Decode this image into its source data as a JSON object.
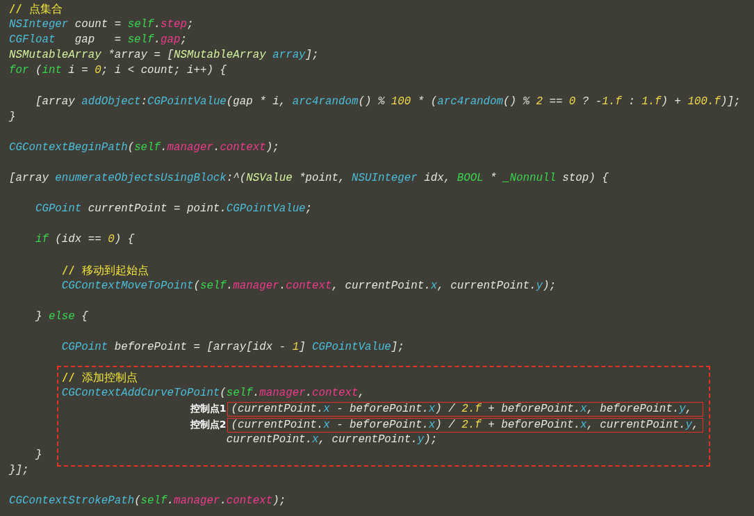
{
  "lines": [
    {
      "kind": "code",
      "tokens": [
        {
          "kind": "comment",
          "text": "// 点集合"
        }
      ]
    },
    {
      "kind": "code",
      "tokens": [
        {
          "kind": "type",
          "text": "NSInteger"
        },
        {
          "kind": "plain",
          "text": " count = "
        },
        {
          "kind": "keyword",
          "text": "self"
        },
        {
          "kind": "plain",
          "text": "."
        },
        {
          "kind": "property",
          "text": "step"
        },
        {
          "kind": "plain",
          "text": ";"
        }
      ]
    },
    {
      "kind": "code",
      "tokens": [
        {
          "kind": "type",
          "text": "CGFloat"
        },
        {
          "kind": "plain",
          "text": "   gap   = "
        },
        {
          "kind": "keyword",
          "text": "self"
        },
        {
          "kind": "plain",
          "text": "."
        },
        {
          "kind": "property",
          "text": "gap"
        },
        {
          "kind": "plain",
          "text": ";"
        }
      ]
    },
    {
      "kind": "code",
      "tokens": [
        {
          "kind": "class",
          "text": "NSMutableArray"
        },
        {
          "kind": "plain",
          "text": " *array = ["
        },
        {
          "kind": "class",
          "text": "NSMutableArray"
        },
        {
          "kind": "type",
          "text": " array"
        },
        {
          "kind": "plain",
          "text": "];"
        }
      ]
    },
    {
      "kind": "code",
      "tokens": [
        {
          "kind": "keyword",
          "text": "for"
        },
        {
          "kind": "plain",
          "text": " ("
        },
        {
          "kind": "keyword",
          "text": "int"
        },
        {
          "kind": "plain",
          "text": " i = "
        },
        {
          "kind": "number",
          "text": "0"
        },
        {
          "kind": "plain",
          "text": "; i < count; i++) {"
        }
      ]
    },
    {
      "kind": "blank"
    },
    {
      "kind": "code",
      "tokens": [
        {
          "kind": "plain",
          "text": "    [array "
        },
        {
          "kind": "type",
          "text": "addObject"
        },
        {
          "kind": "plain",
          "text": ":"
        },
        {
          "kind": "type",
          "text": "CGPointValue"
        },
        {
          "kind": "plain",
          "text": "(gap * i, "
        },
        {
          "kind": "type",
          "text": "arc4random"
        },
        {
          "kind": "plain",
          "text": "() % "
        },
        {
          "kind": "number",
          "text": "100"
        },
        {
          "kind": "plain",
          "text": " * ("
        },
        {
          "kind": "type",
          "text": "arc4random"
        },
        {
          "kind": "plain",
          "text": "() % "
        },
        {
          "kind": "number",
          "text": "2"
        },
        {
          "kind": "plain",
          "text": " == "
        },
        {
          "kind": "number",
          "text": "0"
        },
        {
          "kind": "plain",
          "text": " ? -"
        },
        {
          "kind": "number",
          "text": "1.f"
        },
        {
          "kind": "plain",
          "text": " : "
        },
        {
          "kind": "number",
          "text": "1.f"
        },
        {
          "kind": "plain",
          "text": ") + "
        },
        {
          "kind": "number",
          "text": "100.f"
        },
        {
          "kind": "plain",
          "text": ")];"
        }
      ]
    },
    {
      "kind": "code",
      "tokens": [
        {
          "kind": "plain",
          "text": "}"
        }
      ]
    },
    {
      "kind": "blank"
    },
    {
      "kind": "code",
      "tokens": [
        {
          "kind": "type",
          "text": "CGContextBeginPath"
        },
        {
          "kind": "plain",
          "text": "("
        },
        {
          "kind": "keyword",
          "text": "self"
        },
        {
          "kind": "plain",
          "text": "."
        },
        {
          "kind": "property",
          "text": "manager"
        },
        {
          "kind": "plain",
          "text": "."
        },
        {
          "kind": "property",
          "text": "context"
        },
        {
          "kind": "plain",
          "text": ");"
        }
      ]
    },
    {
      "kind": "blank"
    },
    {
      "kind": "code",
      "tokens": [
        {
          "kind": "plain",
          "text": "[array "
        },
        {
          "kind": "type",
          "text": "enumerateObjectsUsingBlock"
        },
        {
          "kind": "plain",
          "text": ":^("
        },
        {
          "kind": "class",
          "text": "NSValue"
        },
        {
          "kind": "plain",
          "text": " *point, "
        },
        {
          "kind": "type",
          "text": "NSUInteger"
        },
        {
          "kind": "plain",
          "text": " idx, "
        },
        {
          "kind": "keyword",
          "text": "BOOL"
        },
        {
          "kind": "plain",
          "text": " * "
        },
        {
          "kind": "keyword",
          "text": "_Nonnull"
        },
        {
          "kind": "plain",
          "text": " stop) {"
        }
      ]
    },
    {
      "kind": "blank"
    },
    {
      "kind": "code",
      "tokens": [
        {
          "kind": "type",
          "text": "    CGPoint"
        },
        {
          "kind": "plain",
          "text": " currentPoint = point."
        },
        {
          "kind": "type",
          "text": "CGPointValue"
        },
        {
          "kind": "plain",
          "text": ";"
        }
      ]
    },
    {
      "kind": "blank"
    },
    {
      "kind": "code",
      "tokens": [
        {
          "kind": "keyword",
          "text": "    if"
        },
        {
          "kind": "plain",
          "text": " (idx == "
        },
        {
          "kind": "number",
          "text": "0"
        },
        {
          "kind": "plain",
          "text": ") {"
        }
      ]
    },
    {
      "kind": "blank"
    },
    {
      "kind": "code",
      "tokens": [
        {
          "kind": "comment",
          "text": "        // 移动到起始点"
        }
      ]
    },
    {
      "kind": "code",
      "tokens": [
        {
          "kind": "type",
          "text": "        CGContextMoveToPoint"
        },
        {
          "kind": "plain",
          "text": "("
        },
        {
          "kind": "keyword",
          "text": "self"
        },
        {
          "kind": "plain",
          "text": "."
        },
        {
          "kind": "property",
          "text": "manager"
        },
        {
          "kind": "plain",
          "text": "."
        },
        {
          "kind": "property",
          "text": "context"
        },
        {
          "kind": "plain",
          "text": ", currentPoint."
        },
        {
          "kind": "type",
          "text": "x"
        },
        {
          "kind": "plain",
          "text": ", currentPoint."
        },
        {
          "kind": "type",
          "text": "y"
        },
        {
          "kind": "plain",
          "text": ");"
        }
      ]
    },
    {
      "kind": "blank"
    },
    {
      "kind": "code",
      "tokens": [
        {
          "kind": "plain",
          "text": "    } "
        },
        {
          "kind": "keyword",
          "text": "else"
        },
        {
          "kind": "plain",
          "text": " {"
        }
      ]
    },
    {
      "kind": "blank"
    },
    {
      "kind": "code",
      "tokens": [
        {
          "kind": "type",
          "text": "        CGPoint"
        },
        {
          "kind": "plain",
          "text": " beforePoint = [array[idx - "
        },
        {
          "kind": "number",
          "text": "1"
        },
        {
          "kind": "plain",
          "text": "] "
        },
        {
          "kind": "type",
          "text": "CGPointValue"
        },
        {
          "kind": "plain",
          "text": "];"
        }
      ]
    },
    {
      "kind": "blank"
    },
    {
      "kind": "dashed_group",
      "lines": [
        {
          "kind": "code",
          "tokens": [
            {
              "kind": "comment",
              "text": "        // 添加控制点"
            }
          ]
        },
        {
          "kind": "code",
          "tokens": [
            {
              "kind": "type",
              "text": "        CGContextAddCurveToPoint"
            },
            {
              "kind": "plain",
              "text": "("
            },
            {
              "kind": "keyword",
              "text": "self"
            },
            {
              "kind": "plain",
              "text": "."
            },
            {
              "kind": "property",
              "text": "manager"
            },
            {
              "kind": "plain",
              "text": "."
            },
            {
              "kind": "property",
              "text": "context"
            },
            {
              "kind": "plain",
              "text": ","
            }
          ]
        },
        {
          "kind": "annotated",
          "label": "控制点1",
          "tokens": [
            {
              "kind": "plain",
              "text": "(currentPoint."
            },
            {
              "kind": "type",
              "text": "x"
            },
            {
              "kind": "plain",
              "text": " - beforePoint."
            },
            {
              "kind": "type",
              "text": "x"
            },
            {
              "kind": "plain",
              "text": ") / "
            },
            {
              "kind": "number",
              "text": "2.f"
            },
            {
              "kind": "plain",
              "text": " + beforePoint."
            },
            {
              "kind": "type",
              "text": "x"
            },
            {
              "kind": "plain",
              "text": ", beforePoint."
            },
            {
              "kind": "type",
              "text": "y"
            },
            {
              "kind": "plain",
              "text": ","
            }
          ]
        },
        {
          "kind": "annotated",
          "label": "控制点2",
          "tokens": [
            {
              "kind": "plain",
              "text": "(currentPoint."
            },
            {
              "kind": "type",
              "text": "x"
            },
            {
              "kind": "plain",
              "text": " - beforePoint."
            },
            {
              "kind": "type",
              "text": "x"
            },
            {
              "kind": "plain",
              "text": ") / "
            },
            {
              "kind": "number",
              "text": "2.f"
            },
            {
              "kind": "plain",
              "text": " + beforePoint."
            },
            {
              "kind": "type",
              "text": "x"
            },
            {
              "kind": "plain",
              "text": ", currentPoint."
            },
            {
              "kind": "type",
              "text": "y"
            },
            {
              "kind": "plain",
              "text": ","
            }
          ]
        },
        {
          "kind": "code",
          "tokens": [
            {
              "kind": "plain",
              "text": "                                 currentPoint."
            },
            {
              "kind": "type",
              "text": "x"
            },
            {
              "kind": "plain",
              "text": ", currentPoint."
            },
            {
              "kind": "type",
              "text": "y"
            },
            {
              "kind": "plain",
              "text": ");"
            }
          ]
        },
        {
          "kind": "code",
          "tokens": [
            {
              "kind": "plain",
              "text": "    }"
            }
          ]
        }
      ]
    },
    {
      "kind": "code",
      "tokens": [
        {
          "kind": "plain",
          "text": "}];"
        }
      ]
    },
    {
      "kind": "blank"
    },
    {
      "kind": "code",
      "tokens": [
        {
          "kind": "type",
          "text": "CGContextStrokePath"
        },
        {
          "kind": "plain",
          "text": "("
        },
        {
          "kind": "keyword",
          "text": "self"
        },
        {
          "kind": "plain",
          "text": "."
        },
        {
          "kind": "property",
          "text": "manager"
        },
        {
          "kind": "plain",
          "text": "."
        },
        {
          "kind": "property",
          "text": "context"
        },
        {
          "kind": "plain",
          "text": ");"
        }
      ]
    }
  ]
}
